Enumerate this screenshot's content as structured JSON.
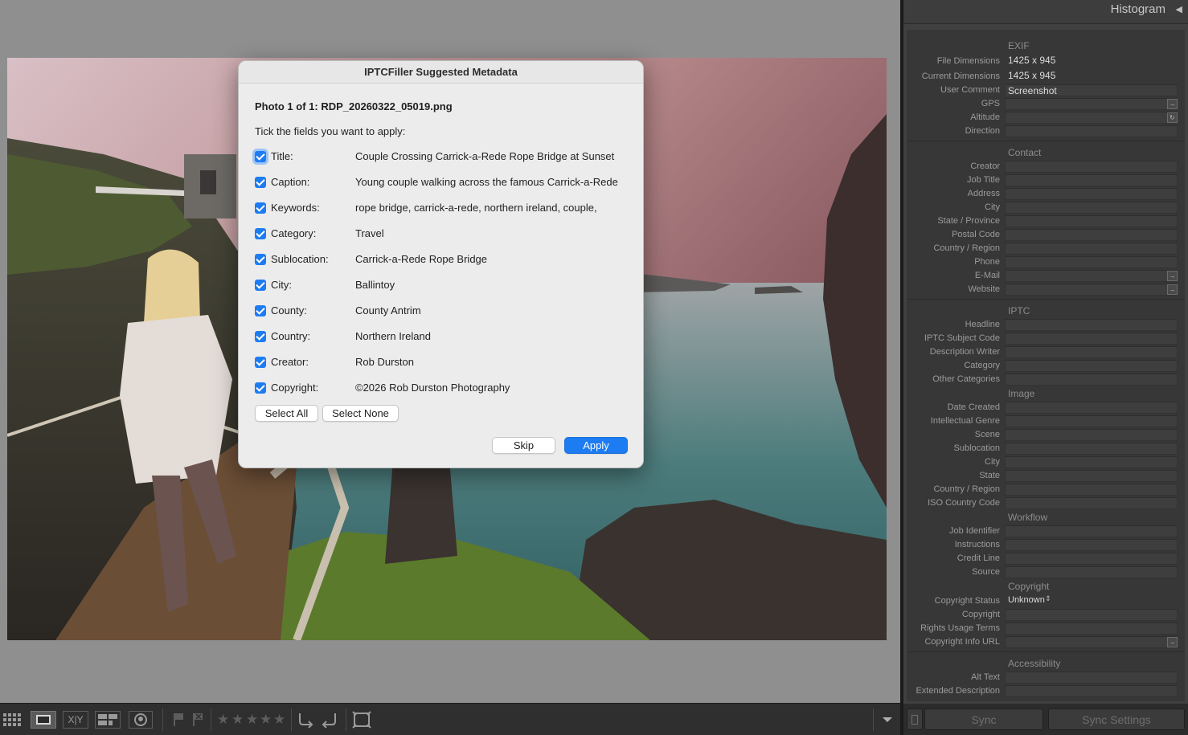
{
  "dialog": {
    "title": "IPTCFiller Suggested Metadata",
    "photo_line": "Photo 1 of 1: RDP_20260322_05019.png",
    "prompt": "Tick the fields you want to apply:",
    "fields": [
      {
        "label": "Title:",
        "value": "Couple Crossing Carrick-a-Rede Rope Bridge at Sunset",
        "checked": true
      },
      {
        "label": "Caption:",
        "value": "Young couple walking across the famous Carrick-a-Rede",
        "checked": true
      },
      {
        "label": "Keywords:",
        "value": "rope bridge, carrick-a-rede, northern ireland, couple,",
        "checked": true
      },
      {
        "label": "Category:",
        "value": "Travel",
        "checked": true
      },
      {
        "label": "Sublocation:",
        "value": "Carrick-a-Rede Rope Bridge",
        "checked": true
      },
      {
        "label": "City:",
        "value": "Ballintoy",
        "checked": true
      },
      {
        "label": "County:",
        "value": "County Antrim",
        "checked": true
      },
      {
        "label": "Country:",
        "value": "Northern Ireland",
        "checked": true
      },
      {
        "label": "Creator:",
        "value": "Rob Durston",
        "checked": true
      },
      {
        "label": "Copyright:",
        "value": "©2026 Rob Durston Photography",
        "checked": true
      }
    ],
    "select_all": "Select All",
    "select_none": "Select None",
    "skip": "Skip",
    "apply": "Apply"
  },
  "panel": {
    "header": "Histogram",
    "exif": {
      "title": "EXIF",
      "file_dimensions_label": "File Dimensions",
      "file_dimensions": "1425 x 945",
      "current_dimensions_label": "Current Dimensions",
      "current_dimensions": "1425 x 945",
      "user_comment_label": "User Comment",
      "user_comment": "Screenshot",
      "gps_label": "GPS",
      "altitude_label": "Altitude",
      "direction_label": "Direction"
    },
    "contact": {
      "title": "Contact",
      "labels": [
        "Creator",
        "Job Title",
        "Address",
        "City",
        "State / Province",
        "Postal Code",
        "Country / Region",
        "Phone",
        "E-Mail",
        "Website"
      ]
    },
    "iptc": {
      "title": "IPTC",
      "labels": [
        "Headline",
        "IPTC Subject Code",
        "Description Writer",
        "Category",
        "Other Categories"
      ]
    },
    "image": {
      "title": "Image",
      "labels": [
        "Date Created",
        "Intellectual Genre",
        "Scene",
        "Sublocation",
        "City",
        "State",
        "Country / Region",
        "ISO Country Code"
      ]
    },
    "workflow": {
      "title": "Workflow",
      "labels": [
        "Job Identifier",
        "Instructions",
        "Credit Line",
        "Source"
      ]
    },
    "copyright": {
      "title": "Copyright",
      "status_label": "Copyright Status",
      "status_value": "Unknown",
      "labels": [
        "Copyright",
        "Rights Usage Terms",
        "Copyright Info URL"
      ]
    },
    "accessibility": {
      "title": "Accessibility",
      "labels": [
        "Alt Text",
        "Extended Description"
      ]
    },
    "sync": "Sync",
    "sync_settings": "Sync Settings"
  },
  "toolbar": {
    "grid_icon": "grid-view-icon",
    "loupe_icon": "loupe-view-icon",
    "compare_label": "X|Y",
    "survey_icon": "survey-view-icon",
    "people_icon": "people-view-icon",
    "rating_stars": 0,
    "colors": {
      "accent": "#1d7cf2",
      "panel": "#404040",
      "toolbar": "#2f2f2f"
    }
  }
}
